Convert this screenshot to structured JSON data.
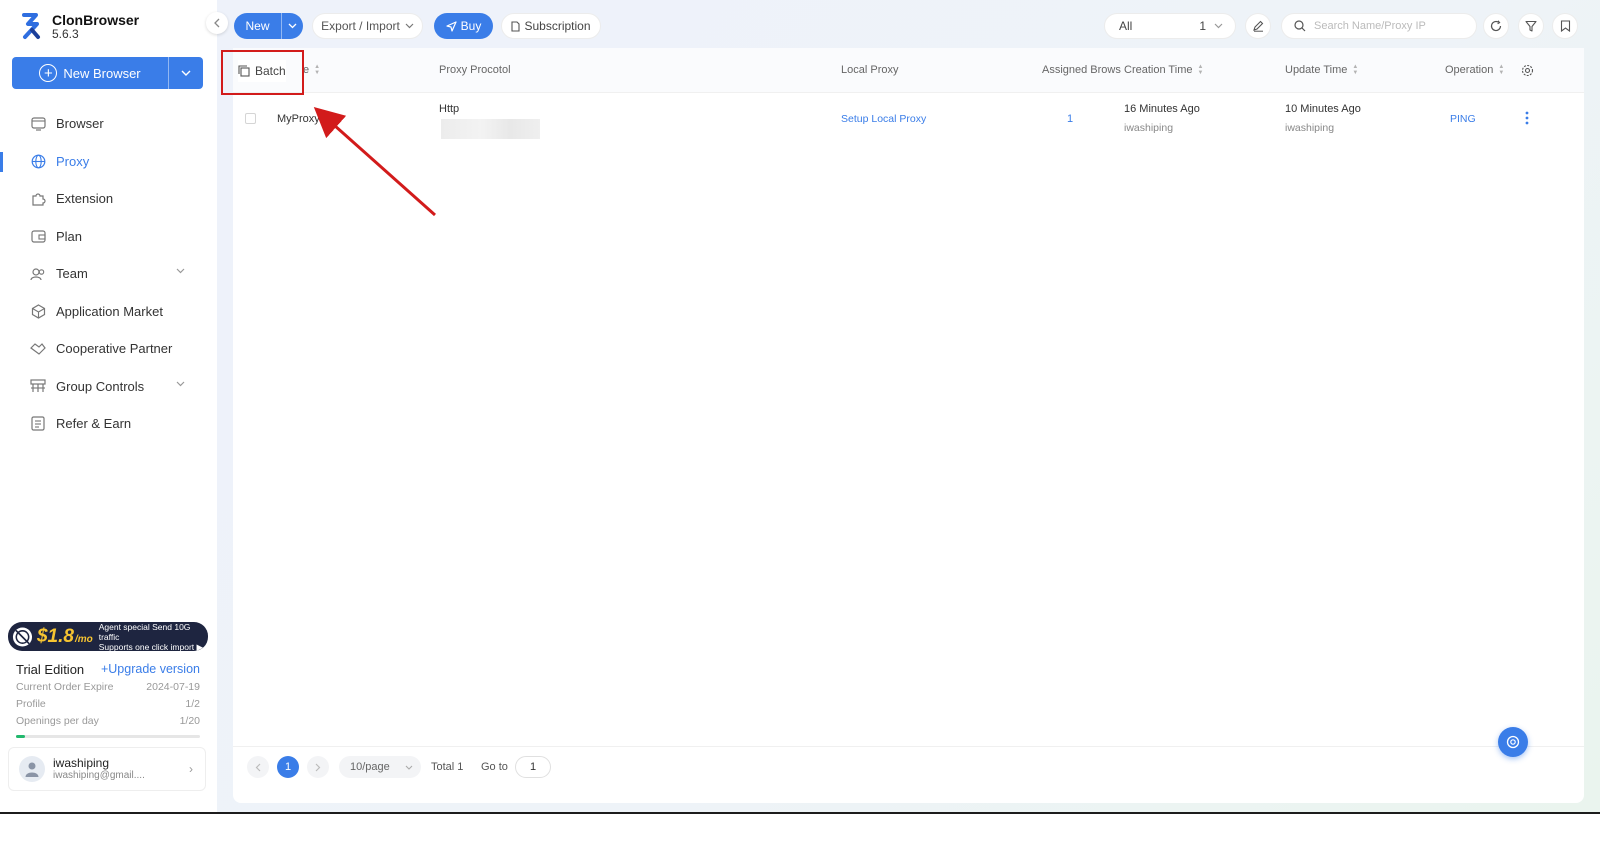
{
  "app": {
    "name": "ClonBrowser",
    "version": "5.6.3"
  },
  "sidebar": {
    "new_browser_label": "New Browser",
    "items": [
      {
        "label": "Browser",
        "icon": "browser-icon",
        "active": false
      },
      {
        "label": "Proxy",
        "icon": "globe-icon",
        "active": true
      },
      {
        "label": "Extension",
        "icon": "puzzle-icon",
        "active": false
      },
      {
        "label": "Plan",
        "icon": "wallet-icon",
        "active": false
      },
      {
        "label": "Team",
        "icon": "team-icon",
        "active": false,
        "expandable": true
      },
      {
        "label": "Application Market",
        "icon": "cube-icon",
        "active": false
      },
      {
        "label": "Cooperative Partner",
        "icon": "handshake-icon",
        "active": false
      },
      {
        "label": "Group Controls",
        "icon": "group-control-icon",
        "active": false,
        "expandable": true
      },
      {
        "label": "Refer & Earn",
        "icon": "refer-icon",
        "active": false
      }
    ],
    "promo": {
      "price": "$1.8",
      "unit": "/mo",
      "line1": "Agent special Send 10G traffic",
      "line2": "Supports one click import ▶"
    },
    "edition": {
      "title": "Trial Edition",
      "upgrade": "+Upgrade version",
      "rows": [
        {
          "label": "Current Order Expire",
          "value": "2024-07-19"
        },
        {
          "label": "Profile",
          "value": "1/2"
        },
        {
          "label": "Openings per day",
          "value": "1/20"
        }
      ],
      "usage_fraction": 0.05
    },
    "user": {
      "name": "iwashiping",
      "email": "iwashiping@gmail...."
    }
  },
  "toolbar": {
    "new_label": "New",
    "export_label": "Export / Import",
    "buy_label": "Buy",
    "subscription_label": "Subscription",
    "filter_value": "All",
    "filter_count": "1",
    "search_placeholder": "Search Name/Proxy IP"
  },
  "table": {
    "batch_label": "Batch",
    "name_header_suffix": "e",
    "headers": {
      "protocol": "Proxy Procotol",
      "local_proxy": "Local Proxy",
      "assigned": "Assigned Brows",
      "created": "Creation Time",
      "updated": "Update Time",
      "operation": "Operation"
    },
    "rows": [
      {
        "name": "MyProxy",
        "protocol": "Http",
        "local_proxy": "Setup Local Proxy",
        "assigned": "1",
        "created": "16 Minutes Ago",
        "created_by": "iwashiping",
        "updated": "10 Minutes Ago",
        "updated_by": "iwashiping",
        "operation": "PING"
      }
    ]
  },
  "pagination": {
    "current_page": "1",
    "page_size": "10/page",
    "total": "Total 1",
    "goto_label": "Go to",
    "goto_value": "1"
  },
  "colors": {
    "accent": "#3a7de8",
    "highlight": "#d21b1b",
    "progress": "#22b86d"
  }
}
